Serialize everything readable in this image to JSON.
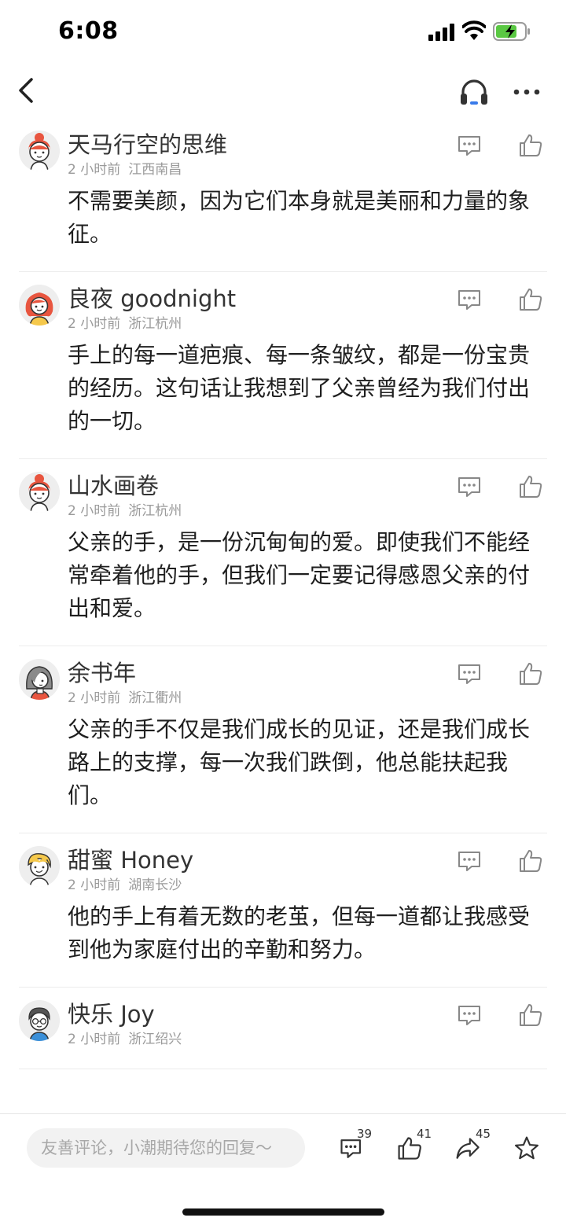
{
  "status_bar": {
    "time": "6:08"
  },
  "nav": {
    "back_icon": "chevron-left-icon",
    "audio_icon": "headphones-icon",
    "more_icon": "more-dots-icon"
  },
  "comments": [
    {
      "name": "天马行空的思维",
      "time": "2 小时前",
      "location": "江西南昌",
      "text": "不需要美颜，因为它们本身就是美丽和力量的象征。",
      "avatar": "woman-bun-red-avatar"
    },
    {
      "name": "良夜 goodnight",
      "time": "2 小时前",
      "location": "浙江杭州",
      "text": "手上的每一道疤痕、每一条皱纹，都是一份宝贵的经历。这句话让我想到了父亲曾经为我们付出的一切。",
      "avatar": "woman-curly-red-avatar"
    },
    {
      "name": "山水画卷",
      "time": "2 小时前",
      "location": "浙江杭州",
      "text": "父亲的手，是一份沉甸甸的爱。即使我们不能经常牵着他的手，但我们一定要记得感恩父亲的付出和爱。",
      "avatar": "woman-bun-red-avatar"
    },
    {
      "name": "余书年",
      "time": "2 小时前",
      "location": "浙江衢州",
      "text": "父亲的手不仅是我们成长的见证，还是我们成长路上的支撑，每一次我们跌倒，他总能扶起我们。",
      "avatar": "woman-gray-hair-avatar"
    },
    {
      "name": "甜蜜 Honey",
      "time": "2 小时前",
      "location": "湖南长沙",
      "text": "他的手上有着无数的老茧，但每一道都让我感受到他为家庭付出的辛勤和努力。",
      "avatar": "boy-yellow-hair-avatar"
    },
    {
      "name": "快乐 Joy",
      "time": "2 小时前",
      "location": "浙江绍兴",
      "text": "",
      "avatar": "man-glasses-avatar"
    }
  ],
  "bottom_bar": {
    "input_placeholder": "友善评论，小潮期待您的回复～",
    "comment_count": "39",
    "like_count": "41",
    "share_count": "45",
    "icons": [
      "comment-icon",
      "thumbs-up-icon",
      "share-icon",
      "star-icon"
    ]
  },
  "colors": {
    "accent_red": "#e8553f",
    "icon_gray": "#888888",
    "text_meta": "#9a9a9a"
  }
}
